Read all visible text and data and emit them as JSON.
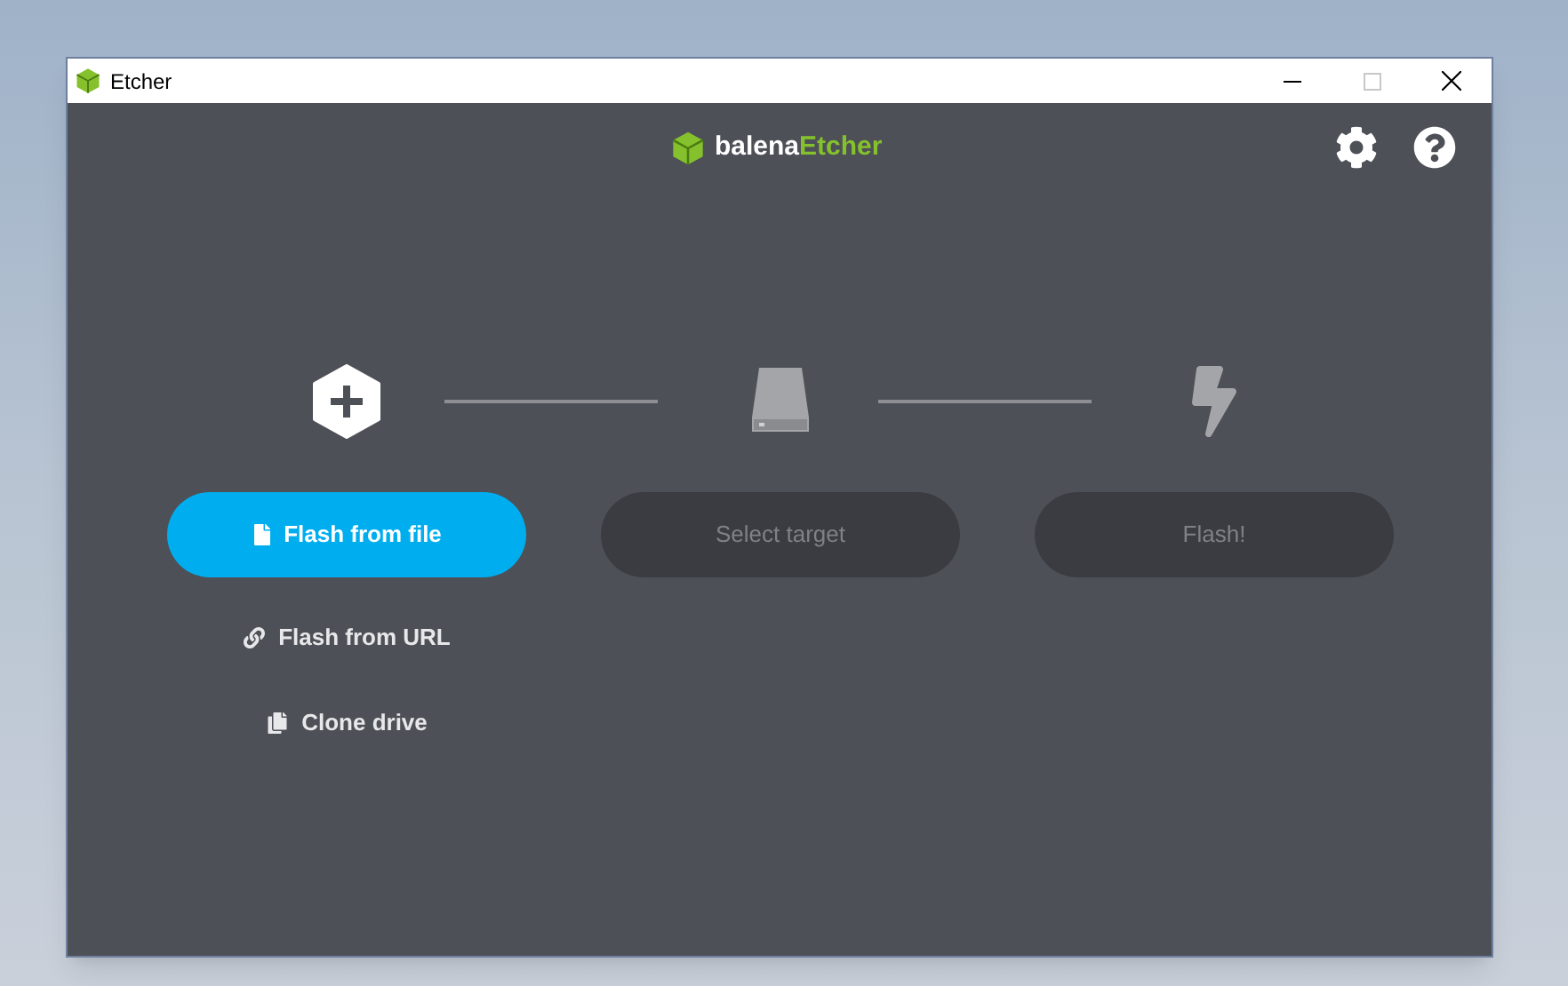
{
  "window": {
    "title": "Etcher",
    "maximize_disabled": true
  },
  "logo": {
    "prefix": "balena",
    "suffix": "Etcher"
  },
  "steps": [
    {
      "kind": "source",
      "button": {
        "label": "Flash from file",
        "disabled": false
      },
      "options": [
        {
          "label": "Flash from URL",
          "kind": "link"
        },
        {
          "label": "Clone drive",
          "kind": "clone"
        }
      ]
    },
    {
      "kind": "target",
      "button": {
        "label": "Select target",
        "disabled": true
      }
    },
    {
      "kind": "flash",
      "button": {
        "label": "Flash!",
        "disabled": true
      }
    }
  ]
}
